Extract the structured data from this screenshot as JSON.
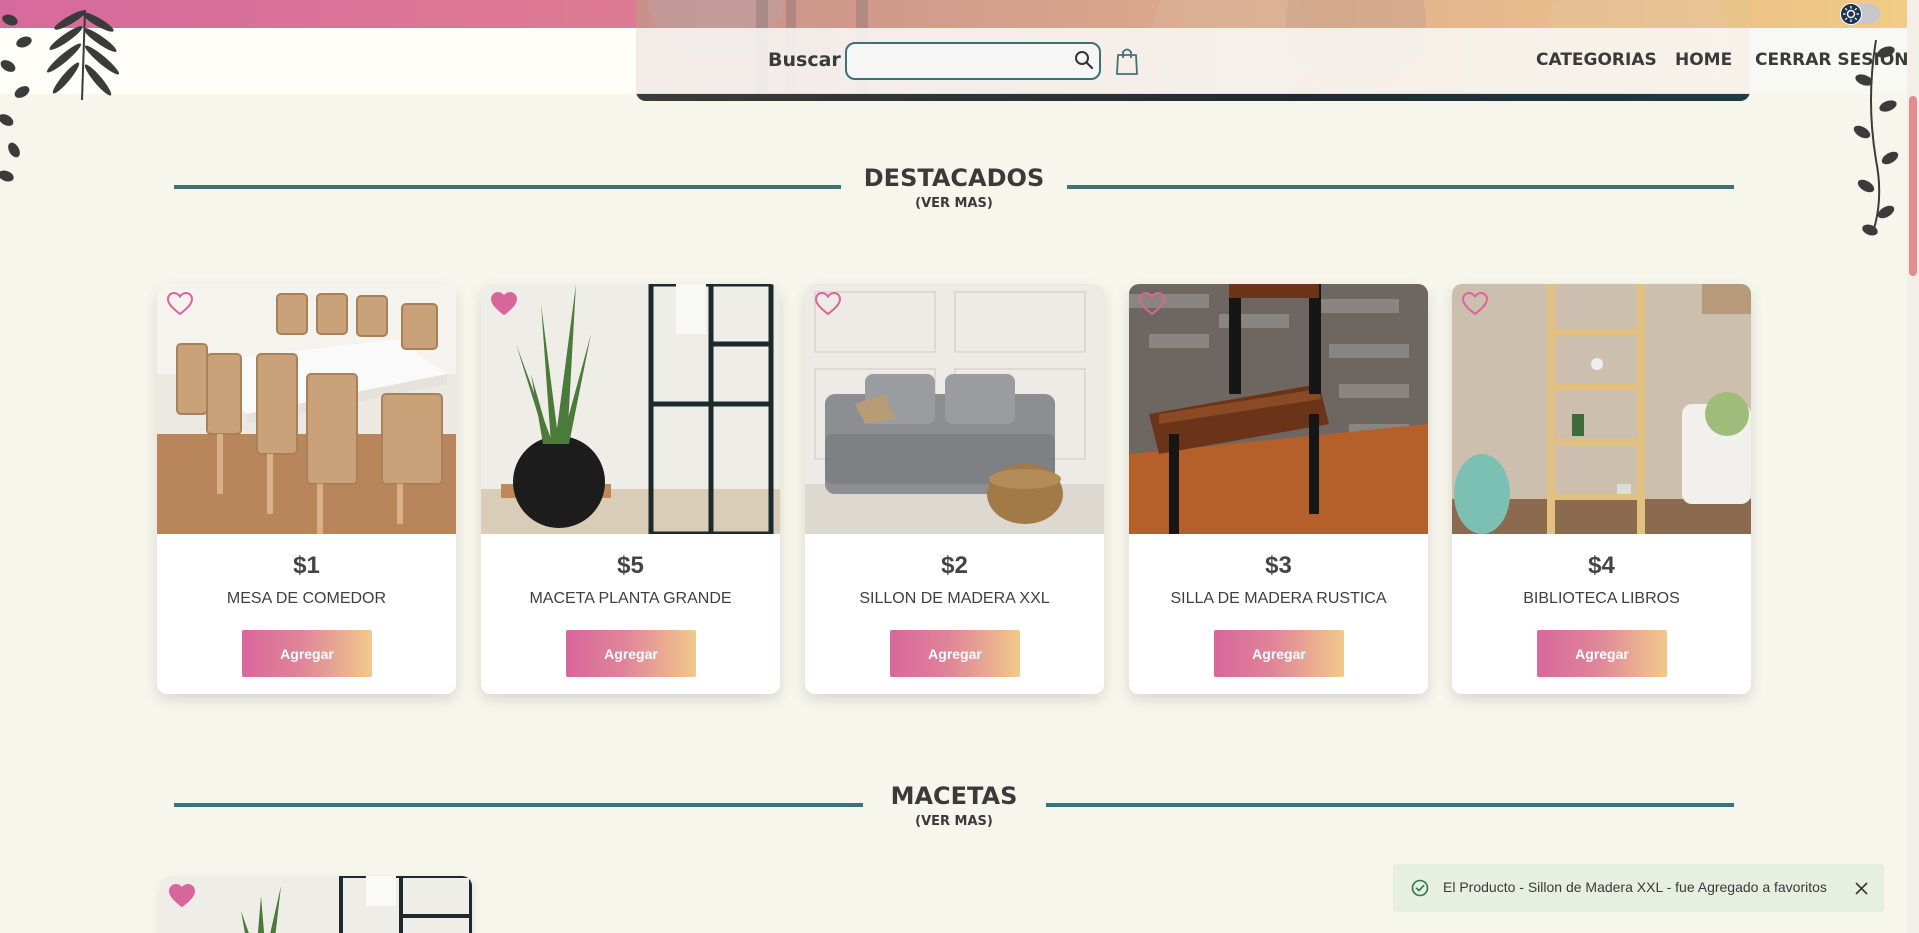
{
  "header": {
    "search_label": "Buscar",
    "search_value": "",
    "search_placeholder": "",
    "nav": [
      "CATEGORIAS",
      "HOME",
      "CERRAR SESION"
    ]
  },
  "sections": [
    {
      "title": "DESTACADOS",
      "more": "(VER MAS)"
    },
    {
      "title": "MACETAS",
      "more": "(VER MAS)"
    }
  ],
  "products": [
    {
      "price": "$1",
      "name": "MESA DE COMEDOR",
      "button": "Agregar",
      "favorite": false
    },
    {
      "price": "$5",
      "name": "MACETA PLANTA GRANDE",
      "button": "Agregar",
      "favorite": true
    },
    {
      "price": "$2",
      "name": "SILLON DE MADERA XXL",
      "button": "Agregar",
      "favorite": false
    },
    {
      "price": "$3",
      "name": "SILLA DE MADERA RUSTICA",
      "button": "Agregar",
      "favorite": false
    },
    {
      "price": "$4",
      "name": "BIBLIOTECA LIBROS",
      "button": "Agregar",
      "favorite": false
    }
  ],
  "toast": {
    "message": "El Producto - Sillon de Madera XXL - fue Agregado a favoritos"
  },
  "colors": {
    "accent_teal": "#3f7278",
    "heart_pink": "#d9659d",
    "button_gradient_start": "#d8679b",
    "button_gradient_end": "#f1c98b",
    "background": "#f7f6ec"
  },
  "icons": [
    "search-icon",
    "shopping-bag-icon",
    "heart-icon",
    "check-circle-icon",
    "close-icon",
    "sun-icon"
  ]
}
